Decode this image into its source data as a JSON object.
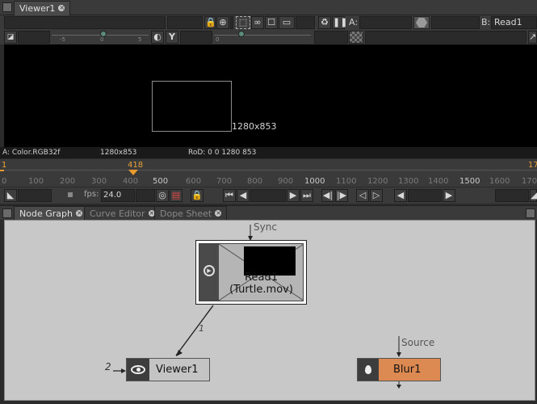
{
  "viewer": {
    "tab_label": "Viewer1",
    "input_a_label": "A:",
    "input_b_label": "B:",
    "input_b_value": "Read1",
    "gain_ticks": [
      "-5",
      "0",
      "5"
    ],
    "gamma_tick": "0",
    "gamma_button": "Y",
    "frame_size_label": "1280x853"
  },
  "info_bar": {
    "channels": "A: Color.RGB32f",
    "format": "1280x853",
    "rod": "RoD: 0 0 1280 853"
  },
  "timeline": {
    "first_frame": "1",
    "last_frame": "17",
    "current_frame": "418",
    "ticks": [
      "0",
      "100",
      "200",
      "300",
      "400",
      "500",
      "600",
      "700",
      "800",
      "900",
      "1000",
      "1100",
      "1200",
      "1300",
      "1400",
      "1500",
      "1600",
      "170"
    ],
    "major_ticks": [
      "500",
      "1000",
      "1500"
    ],
    "fps_label": "fps:",
    "fps_value": "24.0"
  },
  "node_graph_tabs": {
    "node_graph": "Node Graph",
    "curve_editor": "Curve Editor",
    "dope_sheet": "Dope Sheet"
  },
  "nodes": {
    "read": {
      "line1": "Read1",
      "line2": "(Turtle.mov)",
      "input_label": "Sync"
    },
    "viewer": {
      "label": "Viewer1",
      "input_number": "2"
    },
    "blur": {
      "label": "Blur1",
      "input_label": "Source"
    },
    "edge_label": "1"
  },
  "colors": {
    "accent_orange": "#e89a2c",
    "blur_node": "#dd8a52",
    "viewer_node": "#c4c4c4",
    "read_node": "#b0b0b0",
    "graph_bg": "#c8c8c8"
  }
}
